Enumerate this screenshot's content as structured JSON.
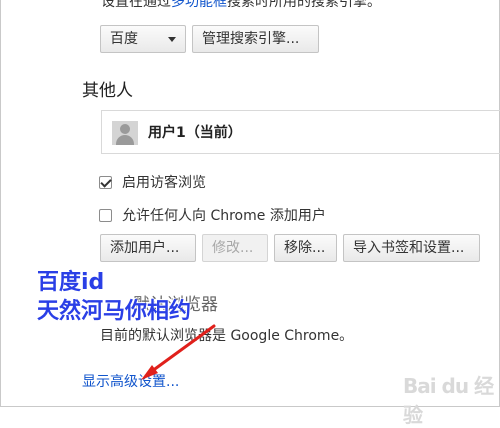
{
  "search": {
    "top_text_a": "设置在通过",
    "top_text_link": "多功能框",
    "top_text_b": "搜索时所用的搜索引擎。",
    "engine_select": "百度",
    "manage_button": "管理搜索引擎..."
  },
  "people": {
    "title": "其他人",
    "user_name": "用户1（当前）",
    "guest_label": "启用访客浏览",
    "guest_checked": true,
    "add_anyone_label": "允许任何人向 Chrome 添加用户",
    "add_anyone_checked": false,
    "add_user_button": "添加用户...",
    "edit_button": "修改...",
    "remove_button": "移除...",
    "import_button": "导入书签和设置..."
  },
  "default_browser": {
    "title": "默认浏览器",
    "description": "目前的默认浏览器是 Google Chrome。"
  },
  "advanced_link": "显示高级设置...",
  "watermark": {
    "line1": "百度id",
    "line2": "天然河马你相约",
    "color": "#2a3fe6"
  },
  "logo_text": "Bai du 经验",
  "colors": {
    "link": "#1155cc",
    "arrow": "#e0201b"
  }
}
